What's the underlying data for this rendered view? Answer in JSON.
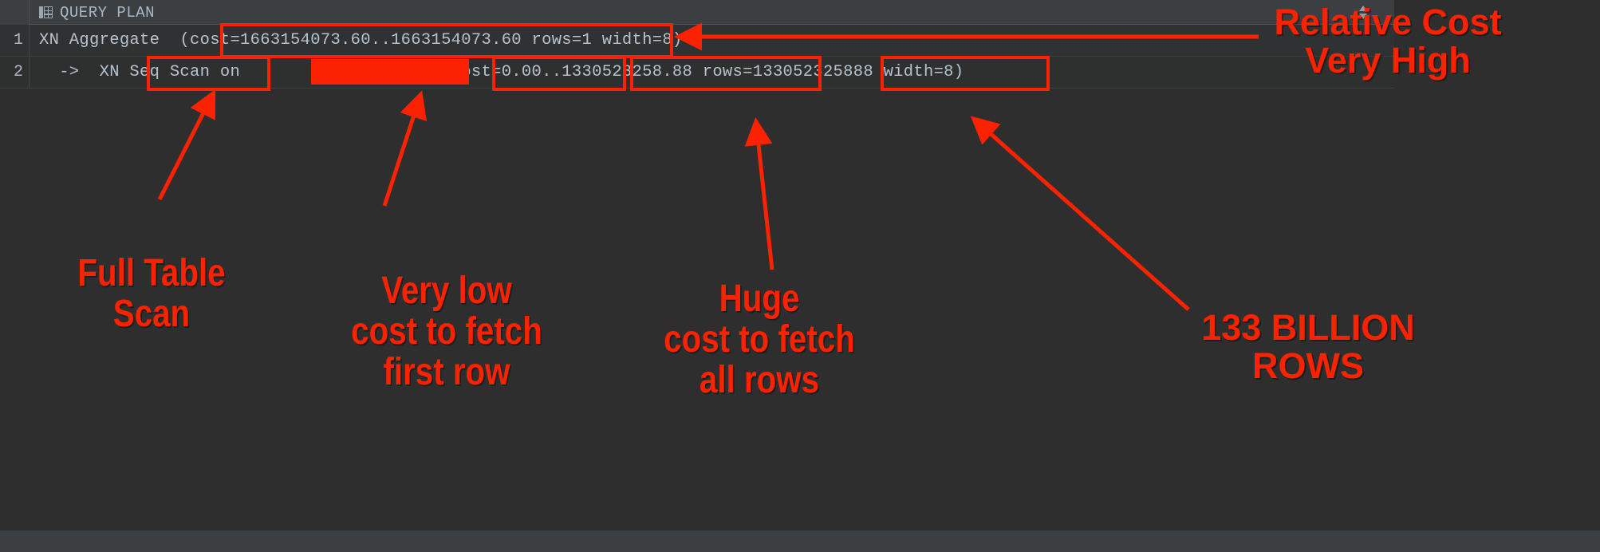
{
  "grid": {
    "header": {
      "column_label": "QUERY PLAN",
      "icon": "table-grid-icon",
      "sort_indicator": "sort-updown-icon"
    },
    "rows": [
      {
        "number": "1",
        "text": "XN Aggregate  (cost=1663154073.60..1663154073.60 rows=1 width=8)"
      },
      {
        "number": "2",
        "text": "  ->  XN Seq Scan on                    (cost=0.00..1330523258.88 rows=133052325888 width=8)"
      }
    ],
    "redacted_table_name": ""
  },
  "annotations": {
    "relative_cost": "Relative Cost\nVery High",
    "full_table_scan": "Full Table\nScan",
    "very_low_cost": "Very low\ncost to fetch\nfirst row",
    "huge_cost": "Huge\ncost to fetch\nall rows",
    "billion_rows": "133 BILLION\nROWS"
  },
  "highlight_color": "#fa2200",
  "text_color": "#b6c3ce"
}
